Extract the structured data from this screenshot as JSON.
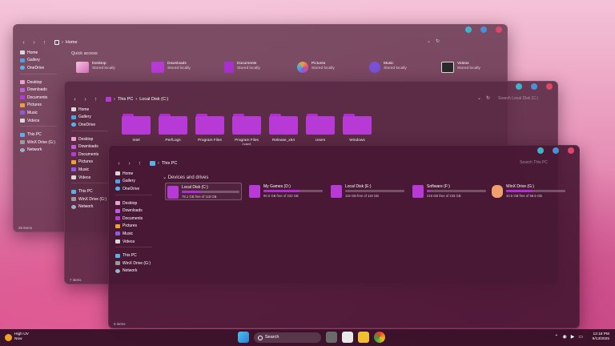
{
  "sidebar_a": {
    "items": [
      "Home",
      "Gallery",
      "OneDrive",
      "Desktop",
      "Downloads",
      "Documents",
      "Pictures",
      "Music",
      "Videos",
      "This PC",
      "WinX Drive (G:)",
      "Network"
    ]
  },
  "win1": {
    "breadcrumb": "Home",
    "quick_access_label": "Quick access",
    "items": [
      {
        "name": "Desktop",
        "sub": "Stored locally"
      },
      {
        "name": "Downloads",
        "sub": "Stored locally"
      },
      {
        "name": "Documents",
        "sub": "Stored locally"
      },
      {
        "name": "Pictures",
        "sub": "Stored locally"
      },
      {
        "name": "Music",
        "sub": "Stored locally"
      },
      {
        "name": "Videos",
        "sub": "Stored locally"
      }
    ],
    "status": "26 items"
  },
  "win2": {
    "breadcrumb": [
      "This PC",
      "Local Disk (C:)"
    ],
    "search_placeholder": "Search Local Disk (C:)",
    "folders": [
      "Intel",
      "PerfLogs",
      "Program Files",
      "Program Files (x86)",
      "Release_x64",
      "Users",
      "Windows"
    ],
    "status": "7 items"
  },
  "win3": {
    "breadcrumb": "This PC",
    "search_placeholder": "Search This PC",
    "section_label": "Devices and drives",
    "drives": [
      {
        "name": "Local Disk (C:)",
        "free": "78.1 GB free of 118 GB",
        "used": 0.34
      },
      {
        "name": "My Games (D:)",
        "free": "90.0 GB free of 232 GB",
        "used": 0.61
      },
      {
        "name": "Local Disk (E:)",
        "free": "119 GB free of 119 GB",
        "used": 0.0
      },
      {
        "name": "Software (F:)",
        "free": "219 GB free of 233 GB",
        "used": 0.06
      },
      {
        "name": "WinX Drive (G:)",
        "free": "32.5 GB free of 58.5 GB",
        "used": 0.44
      }
    ],
    "status": "5 items"
  },
  "taskbar": {
    "weather_title": "High UV",
    "weather_sub": "Now",
    "search": "Search",
    "time": "12:18 PM",
    "date": "9/13/2025"
  },
  "colors": {
    "accent": "#b83ad6",
    "close": "#e0456b",
    "min": "#3fb3c9"
  }
}
